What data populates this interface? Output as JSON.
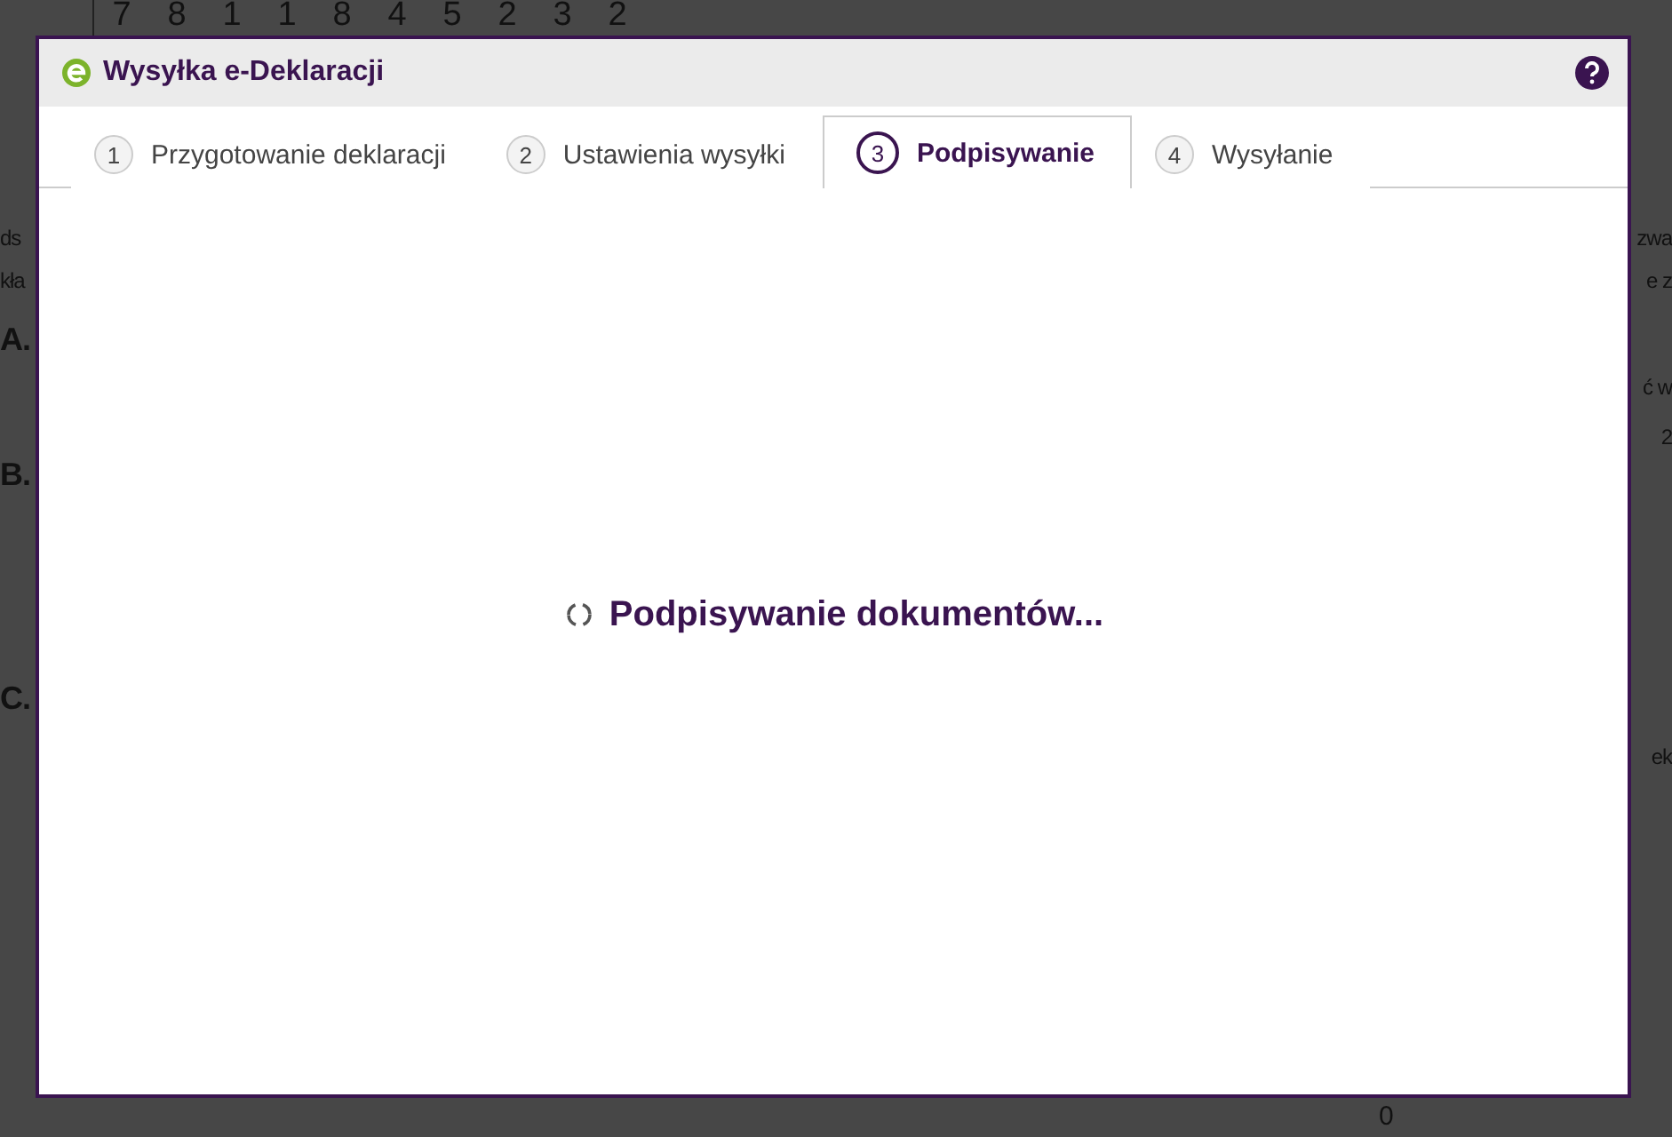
{
  "background": {
    "digits": [
      "7",
      "8",
      "1",
      "1",
      "8",
      "4",
      "5",
      "2",
      "3",
      "2"
    ],
    "left_fragments": [
      "ds",
      "kła",
      "A.",
      "B.",
      "C."
    ],
    "right_fragments": [
      "zwa",
      "e z",
      "ć w",
      "2",
      "ek"
    ],
    "bottom_value": "0"
  },
  "dialog": {
    "title": "Wysyłka e-Deklaracji",
    "tabs": [
      {
        "number": "1",
        "label": "Przygotowanie deklaracji",
        "selected": false
      },
      {
        "number": "2",
        "label": "Ustawienia wysyłki",
        "selected": false
      },
      {
        "number": "3",
        "label": "Podpisywanie",
        "selected": true
      },
      {
        "number": "4",
        "label": "Wysyłanie",
        "selected": false
      }
    ],
    "status": "Podpisywanie dokumentów..."
  }
}
